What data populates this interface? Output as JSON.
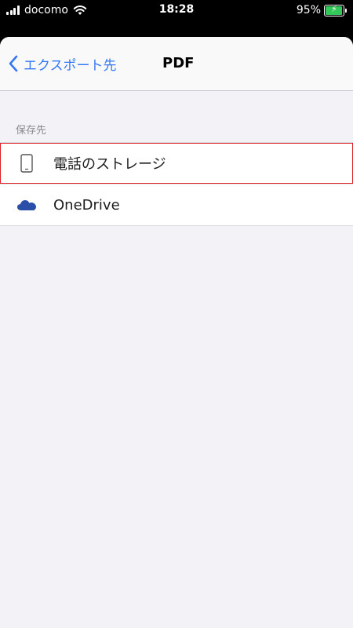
{
  "status_bar": {
    "carrier": "docomo",
    "time": "18:28",
    "battery_percent": "95%",
    "battery_level": 0.95,
    "wifi_icon": "wifi-icon",
    "battery_icon": "battery-charging-icon"
  },
  "nav": {
    "back_label": "エクスポート先",
    "back_icon": "chevron-left-icon",
    "title": "PDF"
  },
  "section": {
    "header": "保存先"
  },
  "destinations": [
    {
      "label": "電話のストレージ",
      "icon": "phone-icon",
      "selected": true
    },
    {
      "label": "OneDrive",
      "icon": "onedrive-cloud-icon",
      "selected": false
    }
  ],
  "colors": {
    "accent": "#3478f6",
    "onedrive": "#2b4fa8",
    "highlight": "#e02020",
    "battery": "#34c759"
  }
}
